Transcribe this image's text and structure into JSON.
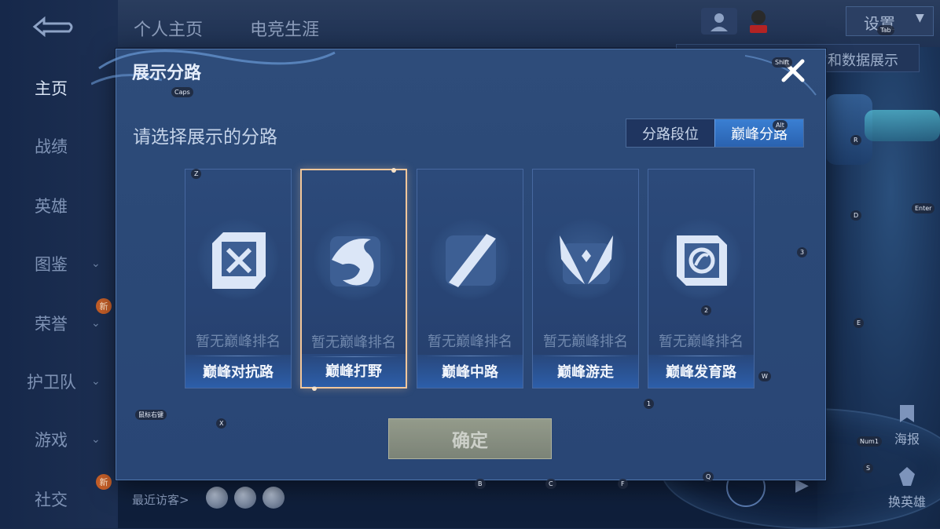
{
  "sidebar": {
    "items": [
      {
        "label": "主页",
        "active": true,
        "expandable": false,
        "new": false
      },
      {
        "label": "战绩",
        "active": false,
        "expandable": false,
        "new": false
      },
      {
        "label": "英雄",
        "active": false,
        "expandable": false,
        "new": false
      },
      {
        "label": "图鉴",
        "active": false,
        "expandable": true,
        "new": false
      },
      {
        "label": "荣誉",
        "active": false,
        "expandable": true,
        "new": true
      },
      {
        "label": "护卫队",
        "active": false,
        "expandable": true,
        "new": false
      },
      {
        "label": "游戏",
        "active": false,
        "expandable": true,
        "new": false
      },
      {
        "label": "社交",
        "active": false,
        "expandable": false,
        "new": true
      }
    ],
    "new_badge": "新",
    "visitors_label": "最近访客>"
  },
  "header": {
    "tabs": [
      "个人主页",
      "电竞生涯"
    ],
    "settings_label": "设置",
    "strip_label": "它和数据展示"
  },
  "right_actions": {
    "poster": "海报",
    "change_hero": "换英雄"
  },
  "modal": {
    "title": "展示分路",
    "prompt": "请选择展示的分路",
    "segments": [
      {
        "label": "分路段位",
        "active": false
      },
      {
        "label": "巅峰分路",
        "active": true
      }
    ],
    "cards": [
      {
        "name": "巅峰对抗路",
        "rank": "暂无巅峰排名",
        "icon": "sword-lane-icon",
        "selected": false
      },
      {
        "name": "巅峰打野",
        "rank": "暂无巅峰排名",
        "icon": "dragon-jungle-icon",
        "selected": true
      },
      {
        "name": "巅峰中路",
        "rank": "暂无巅峰排名",
        "icon": "mid-lane-icon",
        "selected": false
      },
      {
        "name": "巅峰游走",
        "rank": "暂无巅峰排名",
        "icon": "wings-roam-icon",
        "selected": false
      },
      {
        "name": "巅峰发育路",
        "rank": "暂无巅峰排名",
        "icon": "farm-lane-icon",
        "selected": false
      }
    ],
    "confirm_label": "确定"
  },
  "key_hints": [
    "Caps",
    "Shift",
    "Alt",
    "Z",
    "R",
    "D",
    "Enter",
    "3",
    "2",
    "E",
    "W",
    "1",
    "X",
    "Num1",
    "S",
    "B",
    "C",
    "F",
    "Q",
    "Tab",
    "鼠标右键"
  ]
}
